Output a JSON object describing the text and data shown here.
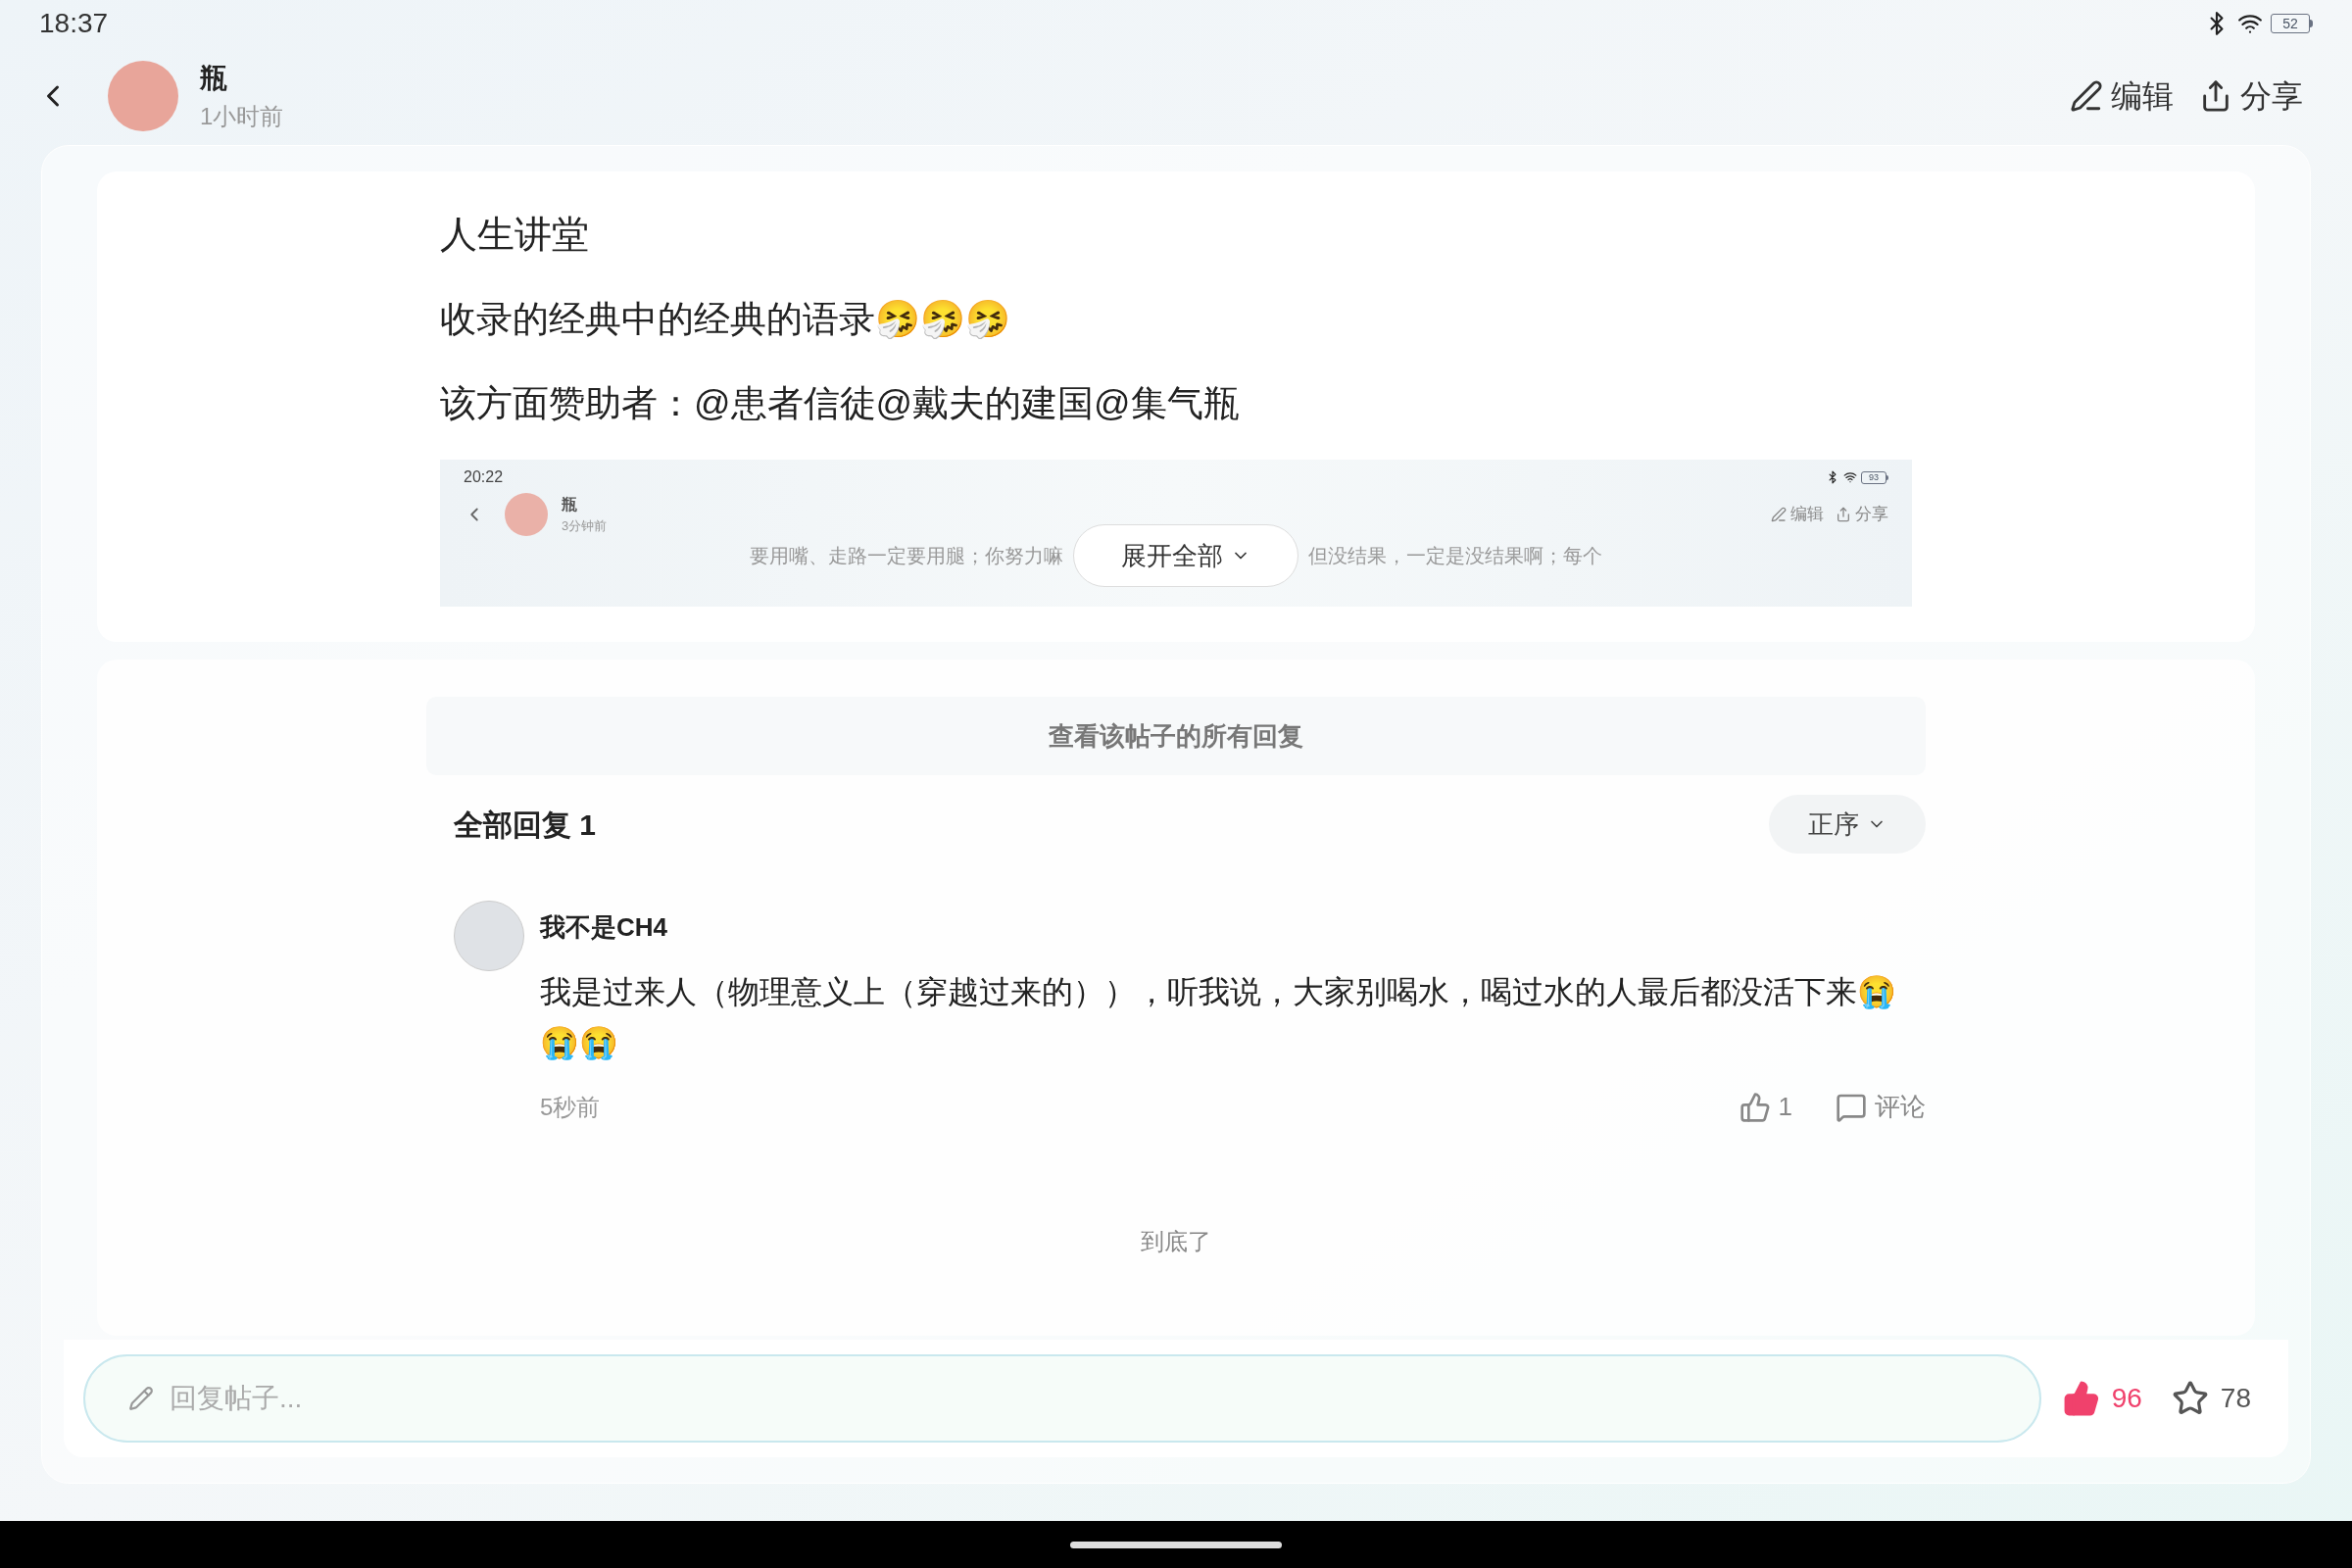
{
  "status_bar": {
    "time": "18:37",
    "battery": "52"
  },
  "header": {
    "author": "瓶",
    "time": "1小时前",
    "actions": [
      "编辑",
      "分享"
    ]
  },
  "post": {
    "title": "人生讲堂",
    "lines": [
      "收录的经典中的经典的语录🤧🤧🤧",
      "该方面赞助者：@患者信徒@戴夫的建国@集气瓶"
    ],
    "preview": {
      "time": "20:22",
      "battery": "93",
      "author": "瓶",
      "posted": "3分钟前",
      "actions": [
        "编辑",
        "分享"
      ],
      "text_left": "要用嘴、走路一定要用腿；你努力嘛",
      "text_right": "但没结果，一定是没结果啊；每个"
    },
    "expand_button": "展开全部"
  },
  "replies": {
    "view_all": "查看该帖子的所有回复",
    "heading": "全部回复 1",
    "sort": "正序",
    "items": [
      {
        "author": "我不是CH4",
        "text": "我是过来人（物理意义上（穿越过来的）），听我说，大家别喝水，喝过水的人最后都没活下来😭😭😭",
        "time": "5秒前",
        "likes": "1",
        "liked": false,
        "comment": "评论"
      }
    ],
    "end": "到底了"
  },
  "reply_bar": {
    "placeholder": "回复帖子...",
    "likes": "96",
    "liked": true,
    "stars": "78",
    "starred": false
  }
}
